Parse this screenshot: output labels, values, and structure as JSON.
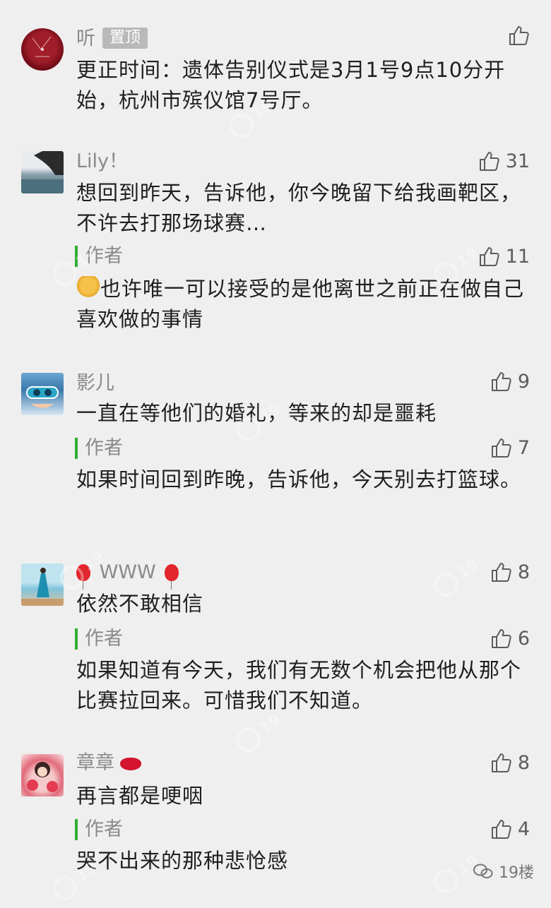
{
  "comments": [
    {
      "name": "听",
      "badge": "置顶",
      "text": "更正时间：遗体告别仪式是3月1号9点10分开始，杭州市殡仪馆7号厅。",
      "likes": ""
    },
    {
      "name": "Lily！",
      "text": "想回到昨天，告诉他，你今晚留下给我画靶区，不许去打那场球赛…",
      "likes": "31",
      "reply": {
        "author_label": "作者",
        "text": "也许唯一可以接受的是他离世之前正在做自己喜欢做的事情",
        "likes": "11"
      }
    },
    {
      "name": "影儿",
      "text": "一直在等他们的婚礼，等来的却是噩耗",
      "likes": "9",
      "reply": {
        "author_label": "作者",
        "text": "如果时间回到昨晚，告诉他，今天别去打篮球。",
        "likes": "7"
      }
    },
    {
      "name": "WWW",
      "text": "依然不敢相信",
      "likes": "8",
      "reply": {
        "author_label": "作者",
        "text": "如果知道有今天，我们有无数个机会把他从那个比赛拉回来。可惜我们不知道。",
        "likes": "6"
      }
    },
    {
      "name": "章章",
      "text": "再言都是哽咽",
      "likes": "8",
      "reply": {
        "author_label": "作者",
        "text": "哭不出来的那种悲怆感",
        "likes": "4"
      }
    }
  ],
  "brand": "19楼",
  "icons": {
    "like": "thumbs-up-icon",
    "brand": "wechat-icon"
  },
  "colors": {
    "background": "#efefef",
    "author_bar": "#2fae2f",
    "name": "#8a8a8a"
  }
}
